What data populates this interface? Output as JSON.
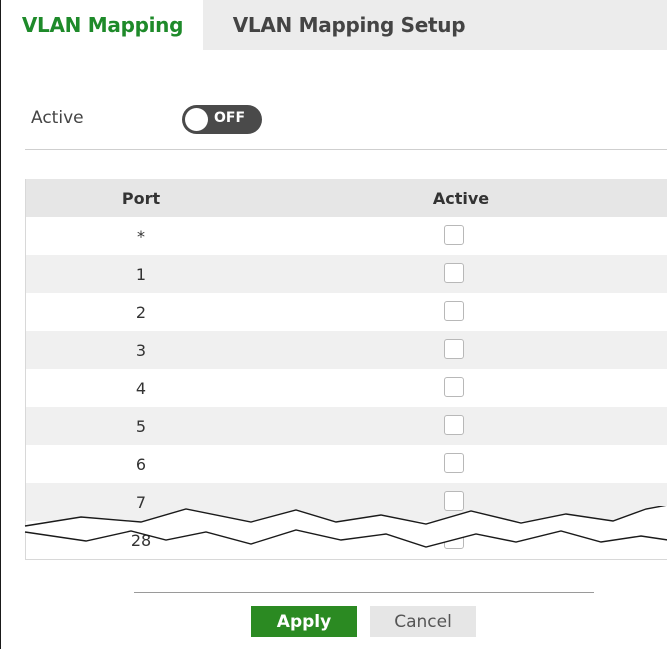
{
  "tabs": [
    {
      "label": "VLAN Mapping",
      "active": true
    },
    {
      "label": "VLAN Mapping Setup",
      "active": false
    }
  ],
  "settings": {
    "active_label": "Active",
    "toggle_state": "OFF"
  },
  "table": {
    "headers": [
      "Port",
      "Active"
    ],
    "rows": [
      {
        "port": "*",
        "active": false
      },
      {
        "port": "1",
        "active": false
      },
      {
        "port": "2",
        "active": false
      },
      {
        "port": "3",
        "active": false
      },
      {
        "port": "4",
        "active": false
      },
      {
        "port": "5",
        "active": false
      },
      {
        "port": "6",
        "active": false
      },
      {
        "port": "7",
        "active": false
      },
      {
        "port": "28",
        "active": false
      }
    ]
  },
  "buttons": {
    "apply": "Apply",
    "cancel": "Cancel"
  },
  "colors": {
    "accent_green": "#1e8a2a",
    "apply_green": "#2b8a22",
    "toggle_off": "#4a4a4a"
  }
}
